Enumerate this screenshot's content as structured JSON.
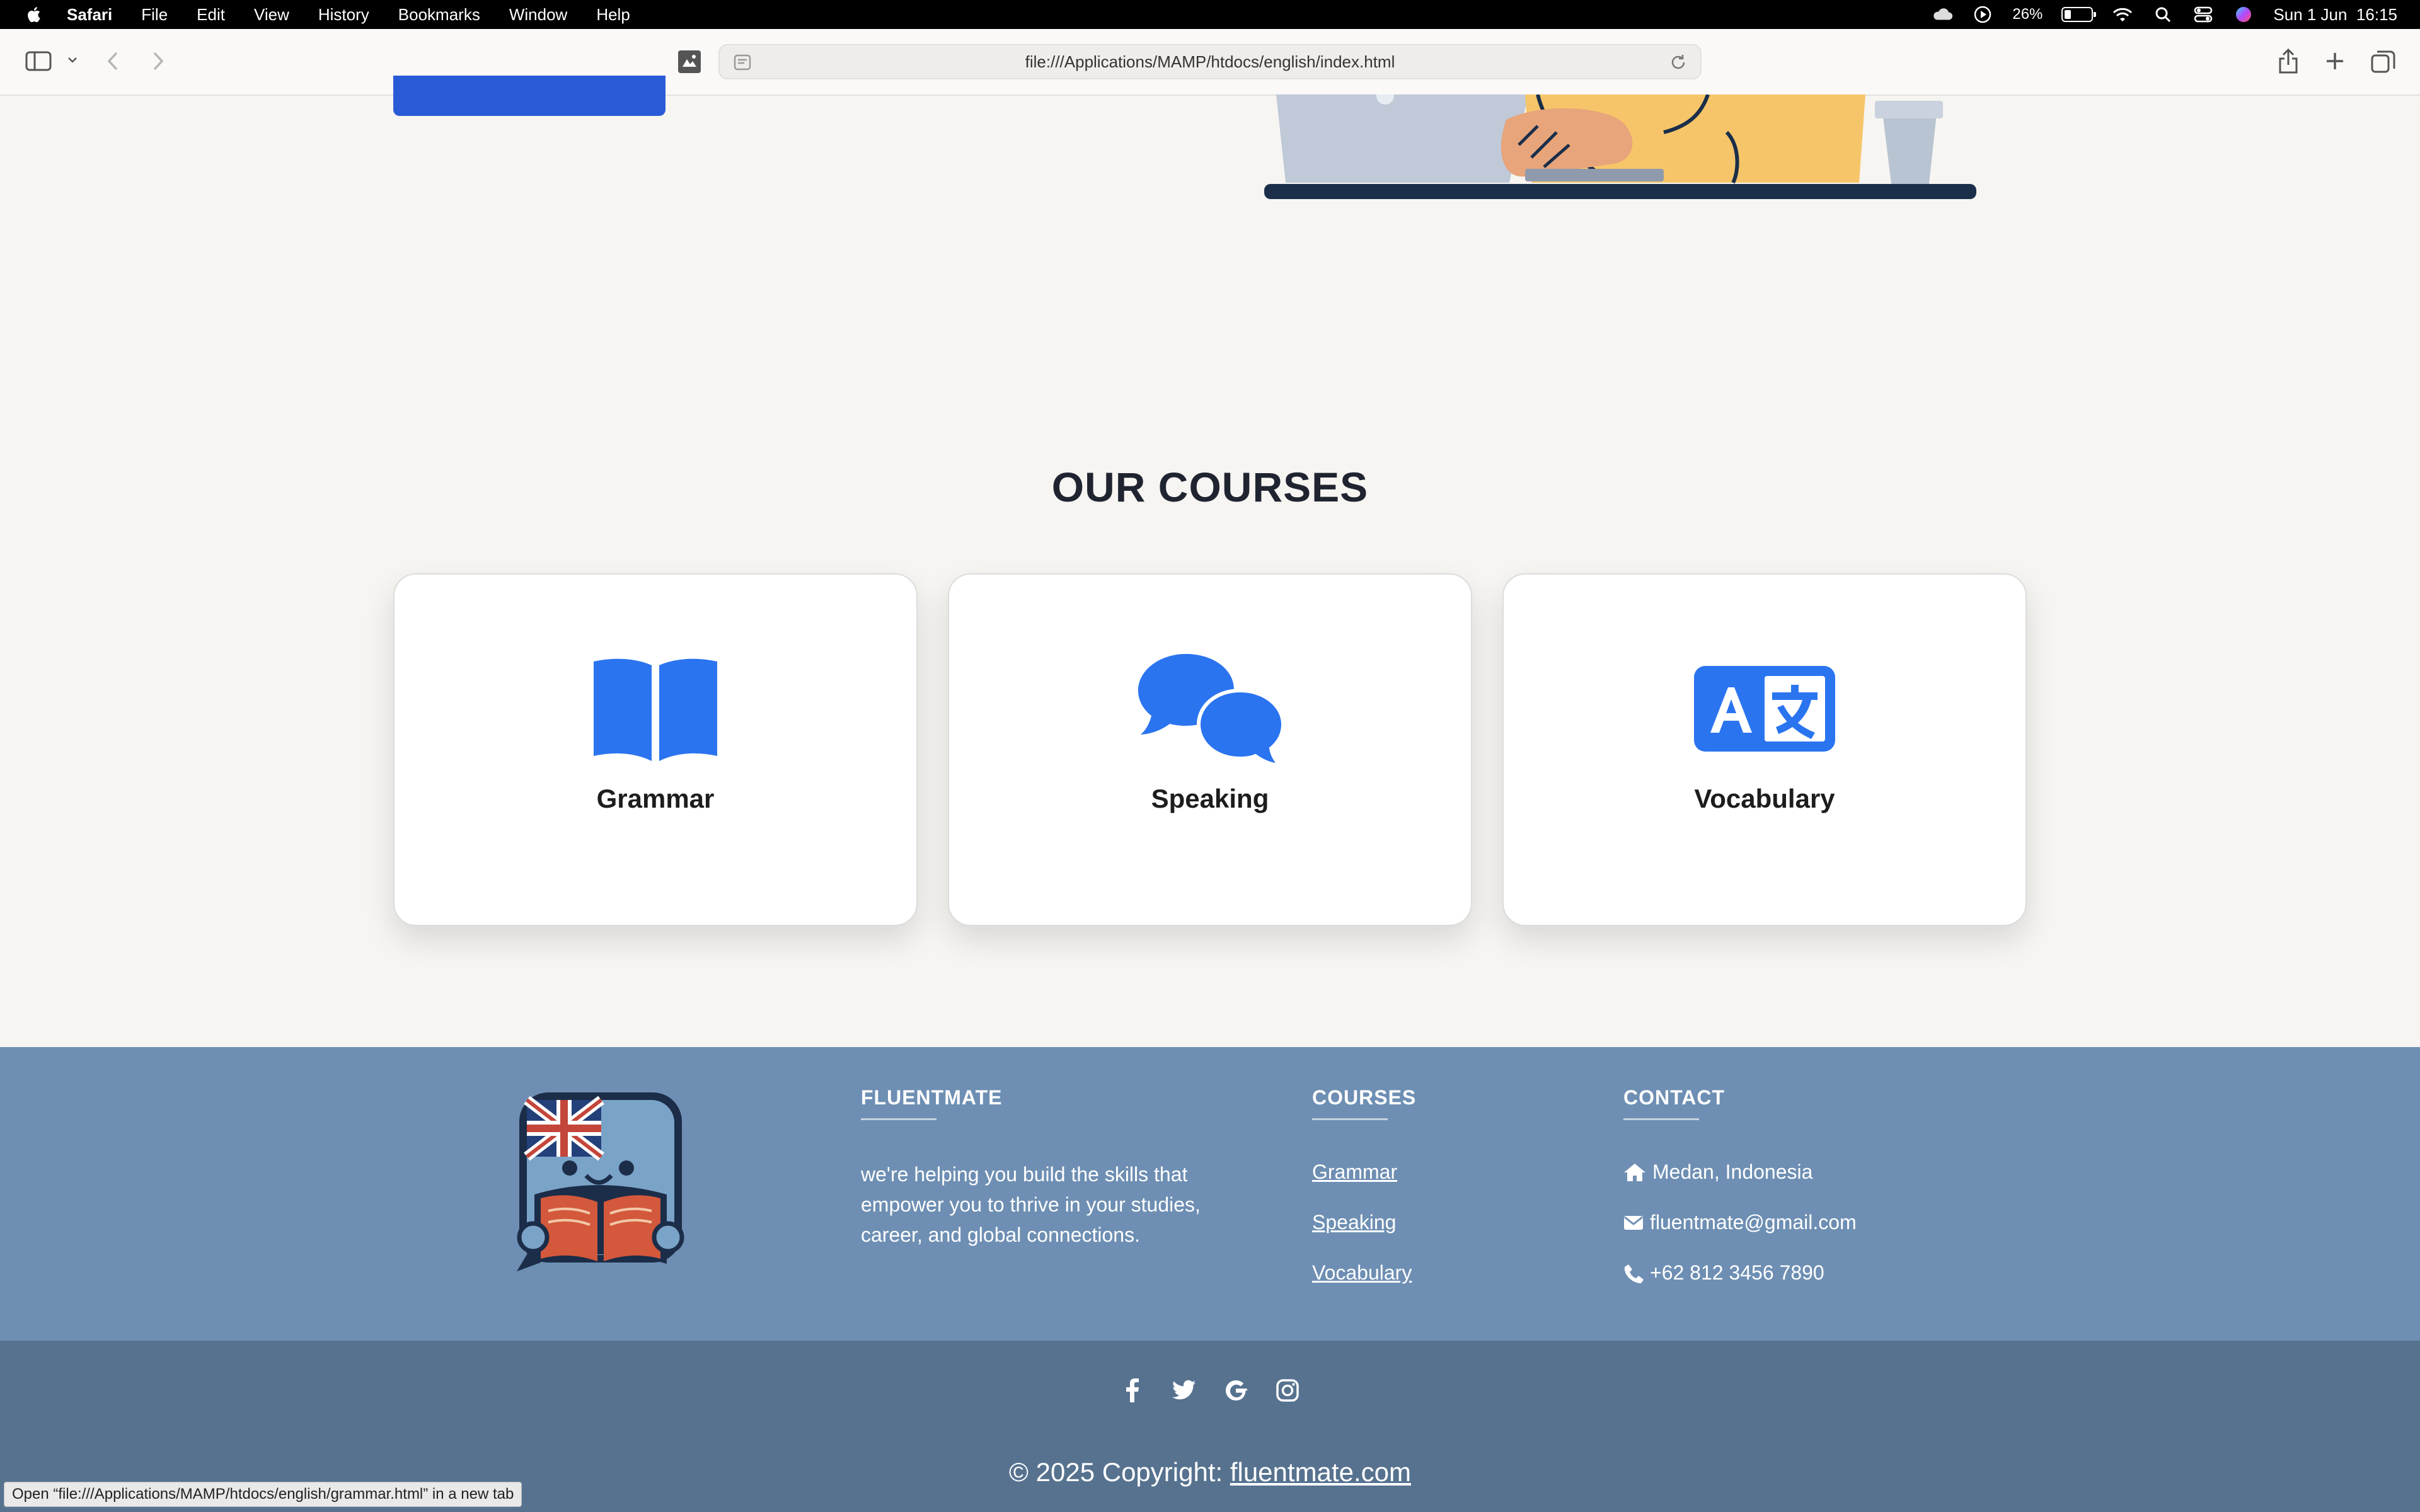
{
  "menubar": {
    "app_name": "Safari",
    "items": [
      "File",
      "Edit",
      "View",
      "History",
      "Bookmarks",
      "Window",
      "Help"
    ],
    "battery_percent": "26%",
    "battery_level": 0.26,
    "datetime": "Sun 1 Jun  16:15"
  },
  "browser": {
    "url": "file:///Applications/MAMP/htdocs/english/index.html",
    "status_text": "Open “file:///Applications/MAMP/htdocs/english/grammar.html” in a new tab"
  },
  "courses": {
    "title": "OUR COURSES",
    "items": [
      {
        "label": "Grammar",
        "icon": "book-open-icon"
      },
      {
        "label": "Speaking",
        "icon": "comments-icon"
      },
      {
        "label": "Vocabulary",
        "icon": "language-icon"
      }
    ]
  },
  "footer": {
    "brand_title": "FLUENTMATE",
    "brand_desc": "we're helping you build the skills that empower you to thrive in your studies, career, and global connections.",
    "courses_title": "COURSES",
    "course_links": [
      "Grammar",
      "Speaking",
      "Vocabulary"
    ],
    "contact_title": "CONTACT",
    "contact": {
      "address": "Medan, Indonesia",
      "email": "fluentmate@gmail.com",
      "phone": "+62 812 3456 7890"
    },
    "social_icons": [
      "facebook-icon",
      "twitter-icon",
      "google-icon",
      "instagram-icon"
    ],
    "copyright_prefix": "© 2025 Copyright: ",
    "copyright_link": "fluentmate.com"
  },
  "colors": {
    "accent": "#2b74f0",
    "footer_top": "#6e8fb3",
    "footer_bottom": "#56728f",
    "page_bg": "#f7f5f2"
  }
}
